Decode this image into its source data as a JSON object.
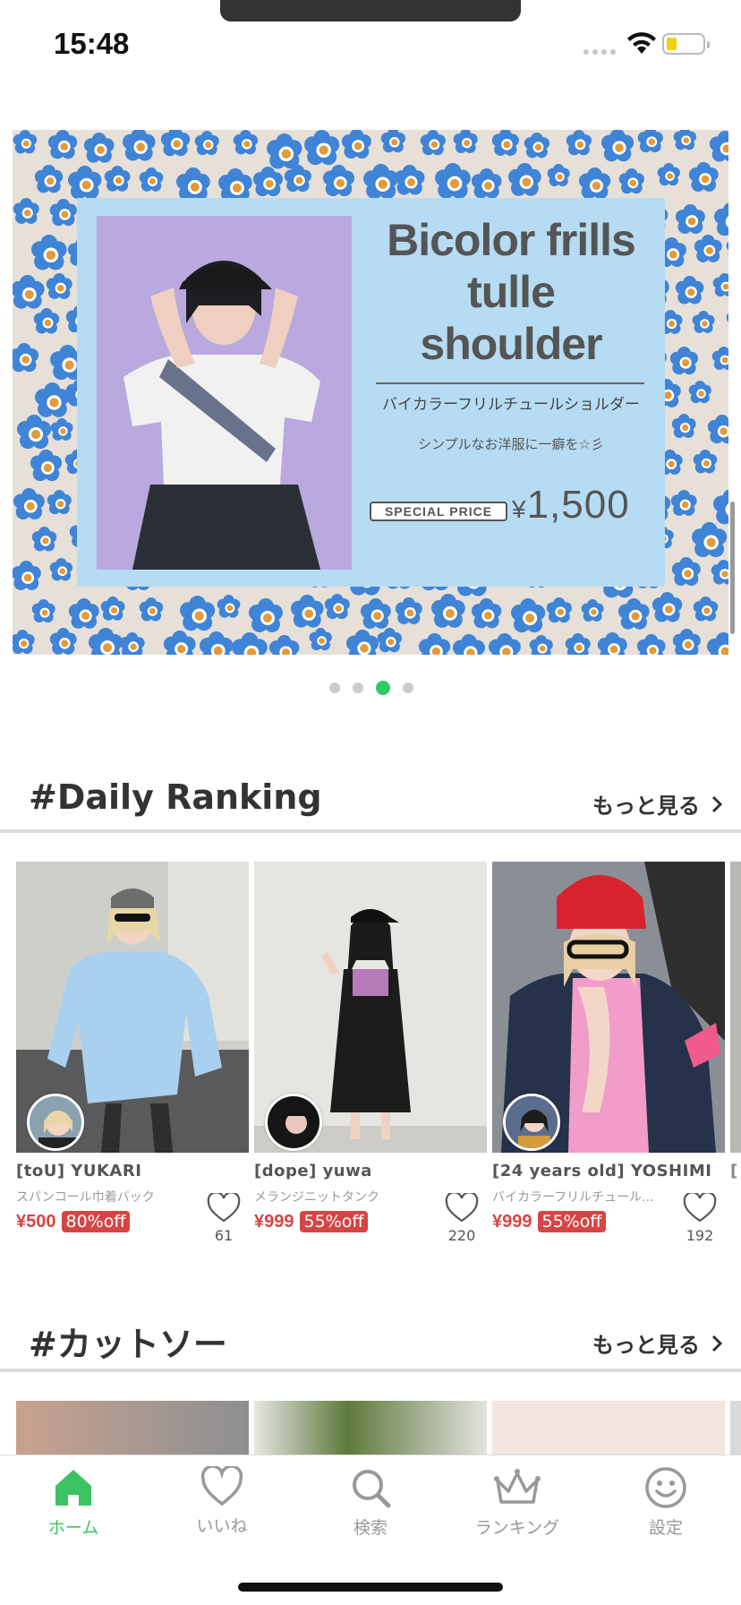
{
  "status_bar": {
    "time": "15:48"
  },
  "banner": {
    "title": "Bicolor frills tulle shoulder",
    "subtitle_jp": "バイカラーフリルチュールショルダー",
    "tagline": "シンプルなお洋服に一癖を☆彡",
    "badge": "SPECIAL PRICE",
    "price_currency": "¥",
    "price_value": "1,500",
    "pagination": {
      "count": 4,
      "active_index": 2
    }
  },
  "daily_ranking": {
    "title": "#Daily Ranking",
    "more_label": "もっと見る",
    "items": [
      {
        "shop": "[toU] YUKARI",
        "name": "スパンコール巾着バック",
        "price": "¥500",
        "discount": "80%off",
        "likes": "61"
      },
      {
        "shop": "[dope] yuwa",
        "name": "メランジニットタンク",
        "price": "¥999",
        "discount": "55%off",
        "likes": "220"
      },
      {
        "shop": "[24 years old] YOSHIMI",
        "name": "バイカラーフリルチュール...",
        "price": "¥999",
        "discount": "55%off",
        "likes": "192"
      }
    ]
  },
  "cutsew": {
    "title": "#カットソー",
    "more_label": "もっと見る"
  },
  "tabbar": {
    "items": [
      {
        "label": "ホーム",
        "icon": "home-icon",
        "active": true
      },
      {
        "label": "いいね",
        "icon": "heart-icon",
        "active": false
      },
      {
        "label": "検索",
        "icon": "search-icon",
        "active": false
      },
      {
        "label": "ランキング",
        "icon": "crown-icon",
        "active": false
      },
      {
        "label": "設定",
        "icon": "smiley-icon",
        "active": false
      }
    ]
  },
  "colors": {
    "accent": "#3cc464",
    "price": "#d64545",
    "banner_bg": "#b6dcf3"
  }
}
